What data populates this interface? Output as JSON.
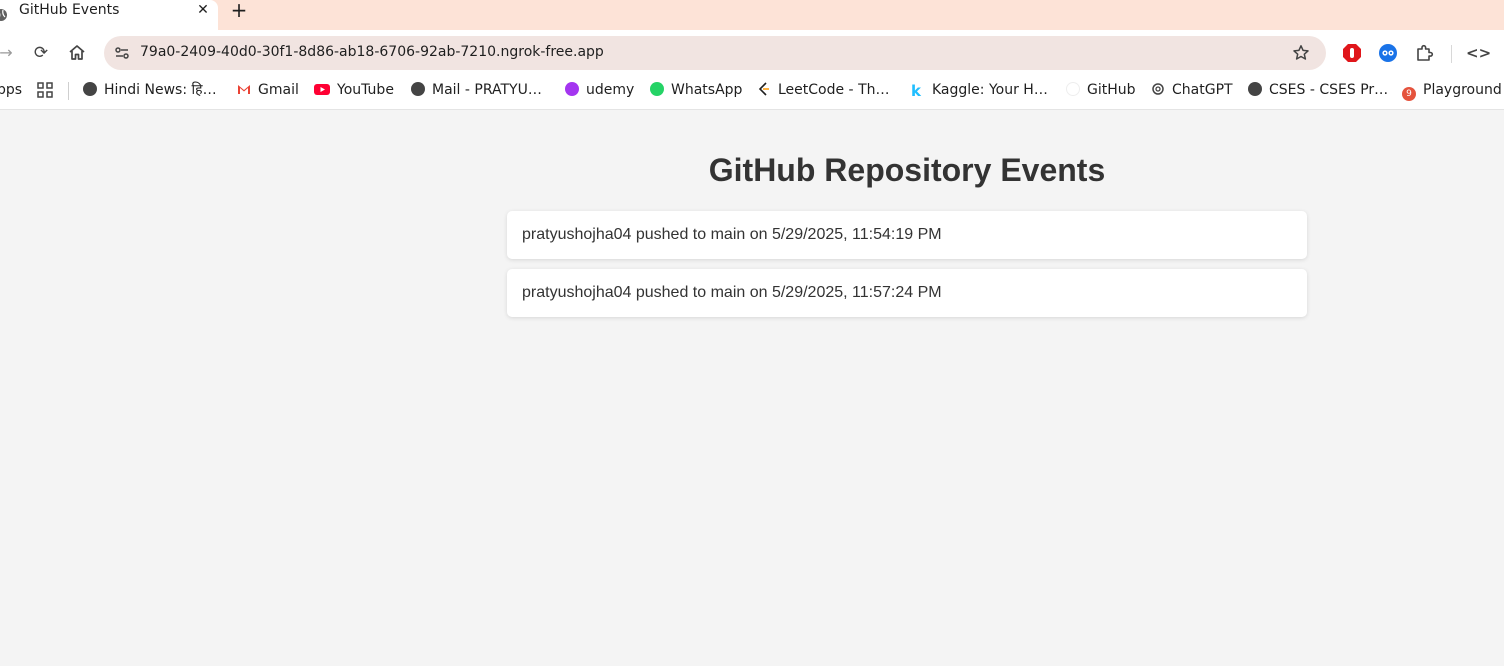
{
  "browser": {
    "tab": {
      "title": "GitHub Events",
      "close_glyph": "✕",
      "favicon": "globe-icon"
    },
    "new_tab_glyph": "+",
    "toolbar": {
      "forward_glyph": "→",
      "reload_glyph": "⟳",
      "url": "79a0-2409-40d0-30f1-8d86-ab18-6706-92ab-7210.ngrok-free.app",
      "devtools_glyph": "<>"
    },
    "bookmarks": {
      "apps_label": "pps",
      "items": [
        {
          "label": "Hindi News: हि…",
          "icon": "globe-icon",
          "color": "#444444"
        },
        {
          "label": "Gmail",
          "icon": "gmail-icon",
          "color": "#ea4335"
        },
        {
          "label": "YouTube",
          "icon": "youtube-icon",
          "color": "#ff0033"
        },
        {
          "label": "Mail - PRATYU…",
          "icon": "globe-icon",
          "color": "#444444"
        },
        {
          "label": "udemy",
          "icon": "udemy-icon",
          "color": "#a435f0"
        },
        {
          "label": "WhatsApp",
          "icon": "whatsapp-icon",
          "color": "#25d366"
        },
        {
          "label": "LeetCode - Th…",
          "icon": "leetcode-icon",
          "color": "#ffa116"
        },
        {
          "label": "Kaggle: Your H…",
          "icon": "kaggle-icon",
          "color": "#20beff"
        },
        {
          "label": "GitHub",
          "icon": "github-icon",
          "color": "#ffffff"
        },
        {
          "label": "ChatGPT",
          "icon": "chatgpt-icon",
          "color": "#444444"
        },
        {
          "label": "CSES - CSES Pr…",
          "icon": "globe-icon",
          "color": "#444444"
        },
        {
          "label": "Playground",
          "icon": "playground-icon",
          "color": "#e5533d",
          "badge": "9"
        }
      ]
    }
  },
  "page": {
    "title": "GitHub Repository Events",
    "events": [
      {
        "text": "pratyushojha04 pushed to main on 5/29/2025, 11:54:19 PM"
      },
      {
        "text": "pratyushojha04 pushed to main on 5/29/2025, 11:57:24 PM"
      }
    ]
  }
}
